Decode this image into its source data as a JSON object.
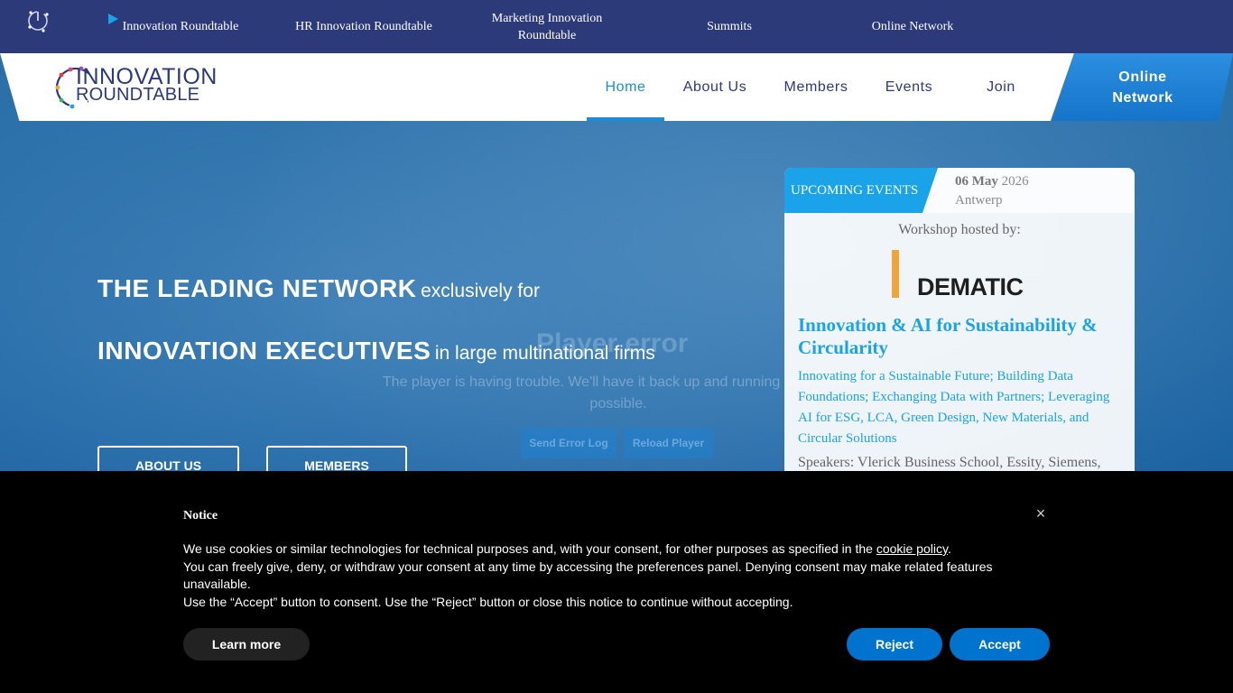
{
  "topbar": {
    "items": [
      {
        "label": "Innovation Roundtable"
      },
      {
        "label": "HR Innovation Roundtable"
      },
      {
        "label": "Marketing Innovation Roundtable"
      },
      {
        "label": "Summits"
      },
      {
        "label": "Online Network"
      }
    ]
  },
  "brand": {
    "line1": "INNOVATION",
    "line2": "ROUNDTABLE",
    "logo_icon": "innovation-roundtable-logo"
  },
  "nav": {
    "items": [
      {
        "label": "Home",
        "active": true
      },
      {
        "label": "About Us"
      },
      {
        "label": "Members"
      },
      {
        "label": "Events"
      },
      {
        "label": "Join"
      }
    ],
    "cta_line1": "Online",
    "cta_line2": "Network"
  },
  "hero": {
    "line1_bold": "THE LEADING NETWORK",
    "line1_rest": "exclusively for",
    "line2_bold": "INNOVATION EXECUTIVES",
    "line2_rest": "in large multinational firms",
    "buttons": [
      {
        "label": "ABOUT US"
      },
      {
        "label": "MEMBERS"
      }
    ]
  },
  "player": {
    "title": "Player error",
    "message": "The player is having trouble. We'll have it back up and running as soon as possible.",
    "send_log": "Send Error Log",
    "reload": "Reload Player"
  },
  "events": {
    "tab_label": "UPCOMING EVENTS",
    "date_day": "06 May",
    "date_year": "2026",
    "location": "Antwerp",
    "hosted_by": "Workshop hosted by:",
    "host_logo_text": "DEMATIC",
    "title": "Innovation & AI for Sustainability & Circularity",
    "description": "Innovating for a Sustainable Future; Building Data Foundations; Exchanging Data with Partners; Leveraging AI for ESG, LCA, Green Design, New Materials, and Circular Solutions",
    "speakers": "Speakers: Vlerick Business School, Essity, Siemens,"
  },
  "cookie": {
    "title": "Notice",
    "text_before_link": "We use cookies or similar technologies for technical purposes and, with your consent, for other purposes as specified in the ",
    "link_text": "cookie policy",
    "text_after_link": ".",
    "line2": "You can freely give, deny, or withdraw your consent at any time by accessing the preferences panel. Denying consent may make related features unavailable.",
    "line3": "Use the “Accept” button to consent. Use the “Reject” button or close this notice to continue without accepting.",
    "learn_more": "Learn more",
    "reject": "Reject",
    "accept": "Accept",
    "close_symbol": "×"
  },
  "colors": {
    "topbar": "#2c3a7a",
    "accent": "#1a8fd6",
    "event_blue": "#1aa3e8",
    "button_blue": "#0073ce"
  }
}
